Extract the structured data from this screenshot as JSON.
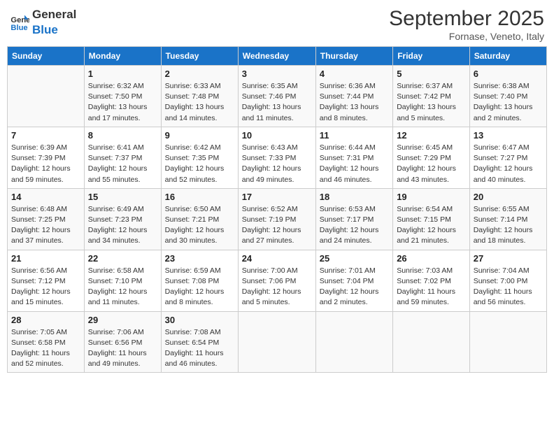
{
  "header": {
    "logo_line1": "General",
    "logo_line2": "Blue",
    "month": "September 2025",
    "location": "Fornase, Veneto, Italy"
  },
  "weekdays": [
    "Sunday",
    "Monday",
    "Tuesday",
    "Wednesday",
    "Thursday",
    "Friday",
    "Saturday"
  ],
  "weeks": [
    [
      {
        "day": "",
        "info": ""
      },
      {
        "day": "1",
        "info": "Sunrise: 6:32 AM\nSunset: 7:50 PM\nDaylight: 13 hours\nand 17 minutes."
      },
      {
        "day": "2",
        "info": "Sunrise: 6:33 AM\nSunset: 7:48 PM\nDaylight: 13 hours\nand 14 minutes."
      },
      {
        "day": "3",
        "info": "Sunrise: 6:35 AM\nSunset: 7:46 PM\nDaylight: 13 hours\nand 11 minutes."
      },
      {
        "day": "4",
        "info": "Sunrise: 6:36 AM\nSunset: 7:44 PM\nDaylight: 13 hours\nand 8 minutes."
      },
      {
        "day": "5",
        "info": "Sunrise: 6:37 AM\nSunset: 7:42 PM\nDaylight: 13 hours\nand 5 minutes."
      },
      {
        "day": "6",
        "info": "Sunrise: 6:38 AM\nSunset: 7:40 PM\nDaylight: 13 hours\nand 2 minutes."
      }
    ],
    [
      {
        "day": "7",
        "info": "Sunrise: 6:39 AM\nSunset: 7:39 PM\nDaylight: 12 hours\nand 59 minutes."
      },
      {
        "day": "8",
        "info": "Sunrise: 6:41 AM\nSunset: 7:37 PM\nDaylight: 12 hours\nand 55 minutes."
      },
      {
        "day": "9",
        "info": "Sunrise: 6:42 AM\nSunset: 7:35 PM\nDaylight: 12 hours\nand 52 minutes."
      },
      {
        "day": "10",
        "info": "Sunrise: 6:43 AM\nSunset: 7:33 PM\nDaylight: 12 hours\nand 49 minutes."
      },
      {
        "day": "11",
        "info": "Sunrise: 6:44 AM\nSunset: 7:31 PM\nDaylight: 12 hours\nand 46 minutes."
      },
      {
        "day": "12",
        "info": "Sunrise: 6:45 AM\nSunset: 7:29 PM\nDaylight: 12 hours\nand 43 minutes."
      },
      {
        "day": "13",
        "info": "Sunrise: 6:47 AM\nSunset: 7:27 PM\nDaylight: 12 hours\nand 40 minutes."
      }
    ],
    [
      {
        "day": "14",
        "info": "Sunrise: 6:48 AM\nSunset: 7:25 PM\nDaylight: 12 hours\nand 37 minutes."
      },
      {
        "day": "15",
        "info": "Sunrise: 6:49 AM\nSunset: 7:23 PM\nDaylight: 12 hours\nand 34 minutes."
      },
      {
        "day": "16",
        "info": "Sunrise: 6:50 AM\nSunset: 7:21 PM\nDaylight: 12 hours\nand 30 minutes."
      },
      {
        "day": "17",
        "info": "Sunrise: 6:52 AM\nSunset: 7:19 PM\nDaylight: 12 hours\nand 27 minutes."
      },
      {
        "day": "18",
        "info": "Sunrise: 6:53 AM\nSunset: 7:17 PM\nDaylight: 12 hours\nand 24 minutes."
      },
      {
        "day": "19",
        "info": "Sunrise: 6:54 AM\nSunset: 7:15 PM\nDaylight: 12 hours\nand 21 minutes."
      },
      {
        "day": "20",
        "info": "Sunrise: 6:55 AM\nSunset: 7:14 PM\nDaylight: 12 hours\nand 18 minutes."
      }
    ],
    [
      {
        "day": "21",
        "info": "Sunrise: 6:56 AM\nSunset: 7:12 PM\nDaylight: 12 hours\nand 15 minutes."
      },
      {
        "day": "22",
        "info": "Sunrise: 6:58 AM\nSunset: 7:10 PM\nDaylight: 12 hours\nand 11 minutes."
      },
      {
        "day": "23",
        "info": "Sunrise: 6:59 AM\nSunset: 7:08 PM\nDaylight: 12 hours\nand 8 minutes."
      },
      {
        "day": "24",
        "info": "Sunrise: 7:00 AM\nSunset: 7:06 PM\nDaylight: 12 hours\nand 5 minutes."
      },
      {
        "day": "25",
        "info": "Sunrise: 7:01 AM\nSunset: 7:04 PM\nDaylight: 12 hours\nand 2 minutes."
      },
      {
        "day": "26",
        "info": "Sunrise: 7:03 AM\nSunset: 7:02 PM\nDaylight: 11 hours\nand 59 minutes."
      },
      {
        "day": "27",
        "info": "Sunrise: 7:04 AM\nSunset: 7:00 PM\nDaylight: 11 hours\nand 56 minutes."
      }
    ],
    [
      {
        "day": "28",
        "info": "Sunrise: 7:05 AM\nSunset: 6:58 PM\nDaylight: 11 hours\nand 52 minutes."
      },
      {
        "day": "29",
        "info": "Sunrise: 7:06 AM\nSunset: 6:56 PM\nDaylight: 11 hours\nand 49 minutes."
      },
      {
        "day": "30",
        "info": "Sunrise: 7:08 AM\nSunset: 6:54 PM\nDaylight: 11 hours\nand 46 minutes."
      },
      {
        "day": "",
        "info": ""
      },
      {
        "day": "",
        "info": ""
      },
      {
        "day": "",
        "info": ""
      },
      {
        "day": "",
        "info": ""
      }
    ]
  ]
}
